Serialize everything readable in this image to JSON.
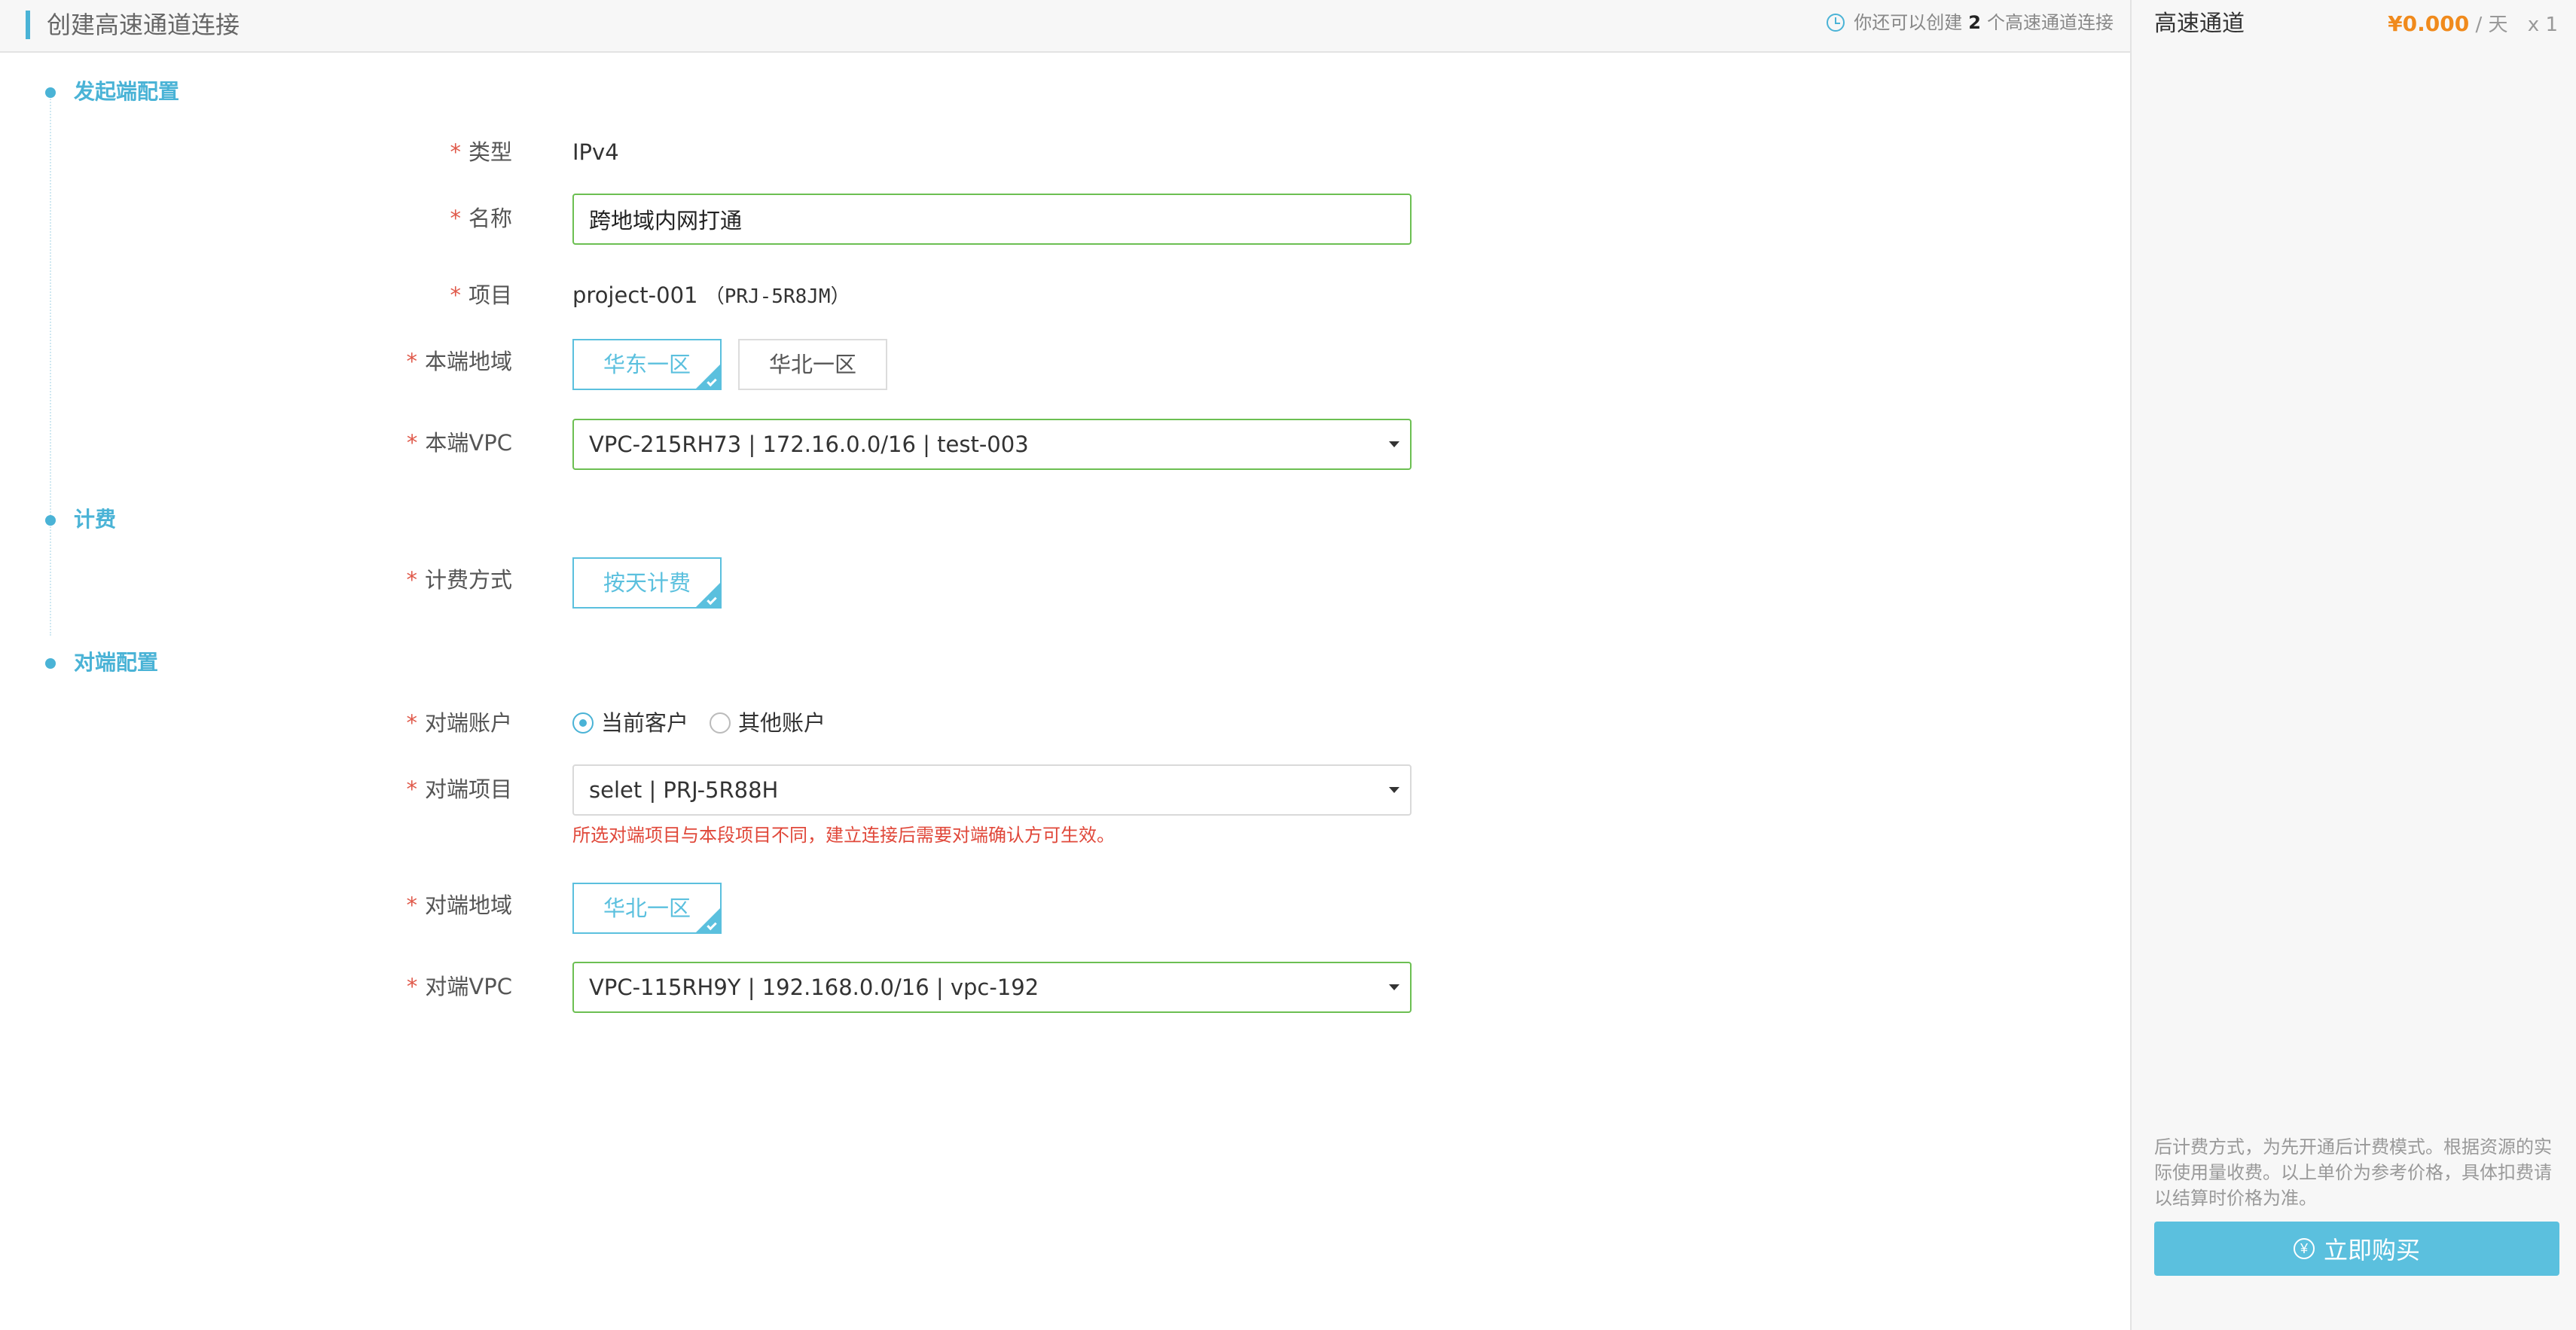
{
  "header": {
    "title": "创建高速通道连接",
    "quota_prefix": "你还可以创建",
    "quota_count": "2",
    "quota_suffix": "个高速通道连接"
  },
  "summary": {
    "product": "高速通道",
    "currency": "¥",
    "amount": "0.000",
    "unit": "/ 天",
    "quantity": "x 1",
    "note": "后计费方式，为先开通后计费模式。根据资源的实际使用量收费。以上单价为参考价格，具体扣费请以结算时价格为准。",
    "buy_label": "立即购买"
  },
  "sections": {
    "initiator": "发起端配置",
    "billing": "计费",
    "peer": "对端配置"
  },
  "form": {
    "required_mark": "*",
    "type_label": "类型",
    "type_value": "IPv4",
    "name_label": "名称",
    "name_value": "跨地域内网打通",
    "project_label": "项目",
    "project_name": "project-001",
    "project_id": "（PRJ-5R8JM）",
    "local_region_label": "本端地域",
    "local_regions": [
      "华东一区",
      "华北一区"
    ],
    "local_region_selected": "华东一区",
    "local_vpc_label": "本端VPC",
    "local_vpc_value": "VPC-215RH73 | 172.16.0.0/16 | test-003",
    "billing_label": "计费方式",
    "billing_value": "按天计费",
    "peer_account_label": "对端账户",
    "peer_account_options": [
      "当前客户",
      "其他账户"
    ],
    "peer_account_selected": "当前客户",
    "peer_project_label": "对端项目",
    "peer_project_value": "selet | PRJ-5R88H",
    "peer_project_warning": "所选对端项目与本段项目不同，建立连接后需要对端确认方可生效。",
    "peer_region_label": "对端地域",
    "peer_region_value": "华北一区",
    "peer_vpc_label": "对端VPC",
    "peer_vpc_value": "VPC-115RH9Y | 192.168.0.0/16 | vpc-192"
  },
  "colors": {
    "accent": "#4ab3d6",
    "price": "#f08a1c",
    "valid_border": "#6cbf52",
    "warning": "#e0483a"
  }
}
